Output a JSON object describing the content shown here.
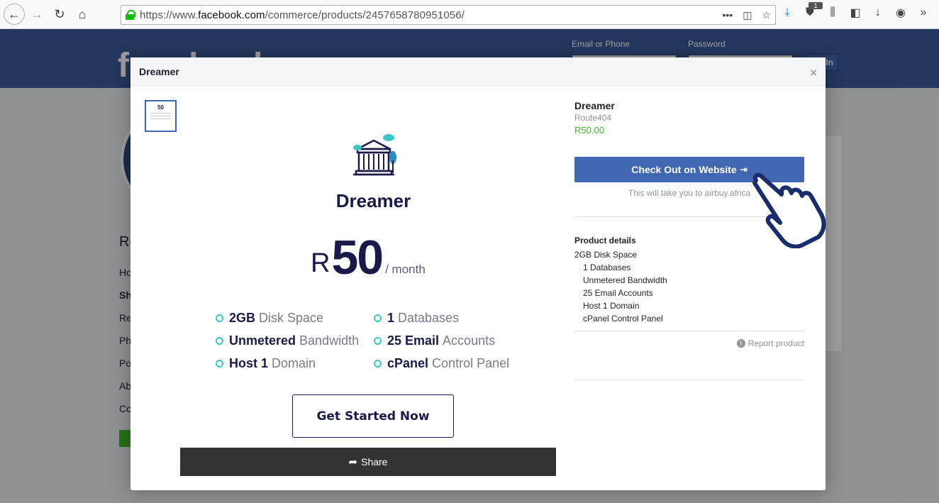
{
  "browser": {
    "url_prefix": "https://www.",
    "url_domain": "facebook.com",
    "url_path": "/commerce/products/2457658780951056/",
    "url_actions": "•••",
    "badge_count": "1"
  },
  "fb_background": {
    "logo": "facebook",
    "email_label": "Email or Phone",
    "password_label": "Password",
    "login_button": "In",
    "sidebar_title": "Re",
    "sidebar_items": [
      "Ho",
      "Sh",
      "Re",
      "Ph",
      "Po",
      "Ab",
      "Co"
    ]
  },
  "modal": {
    "title": "Dreamer",
    "close": "×"
  },
  "product_image": {
    "name": "Dreamer",
    "currency": "R",
    "price": "50",
    "period": "/ month",
    "features": [
      {
        "bold": "2GB",
        "rest": "Disk Space"
      },
      {
        "bold": "1",
        "rest": "Databases"
      },
      {
        "bold": "Unmetered",
        "rest": "Bandwidth"
      },
      {
        "bold": "25 Email",
        "rest": "Accounts"
      },
      {
        "bold": "Host 1",
        "rest": "Domain"
      },
      {
        "bold": "cPanel",
        "rest": "Control Panel"
      }
    ],
    "cta": "Get Started Now",
    "thumb_price": "50"
  },
  "share": {
    "label": "Share"
  },
  "info": {
    "name": "Dreamer",
    "seller": "Route404",
    "price": "R50.00",
    "checkout_label": "Check Out on Website",
    "checkout_note": "This will take you to airbuy.africa",
    "details_title": "Product details",
    "details": [
      "2GB Disk Space",
      "1 Databases",
      "Unmetered Bandwidth",
      "25 Email Accounts",
      "Host 1 Domain",
      "cPanel Control Panel"
    ],
    "report": "Report product"
  },
  "colors": {
    "fb_blue": "#3b5998",
    "button_blue": "#4267b2",
    "price_green": "#42b72a",
    "navy": "#1a1a4a",
    "teal": "#3cc6c6"
  }
}
